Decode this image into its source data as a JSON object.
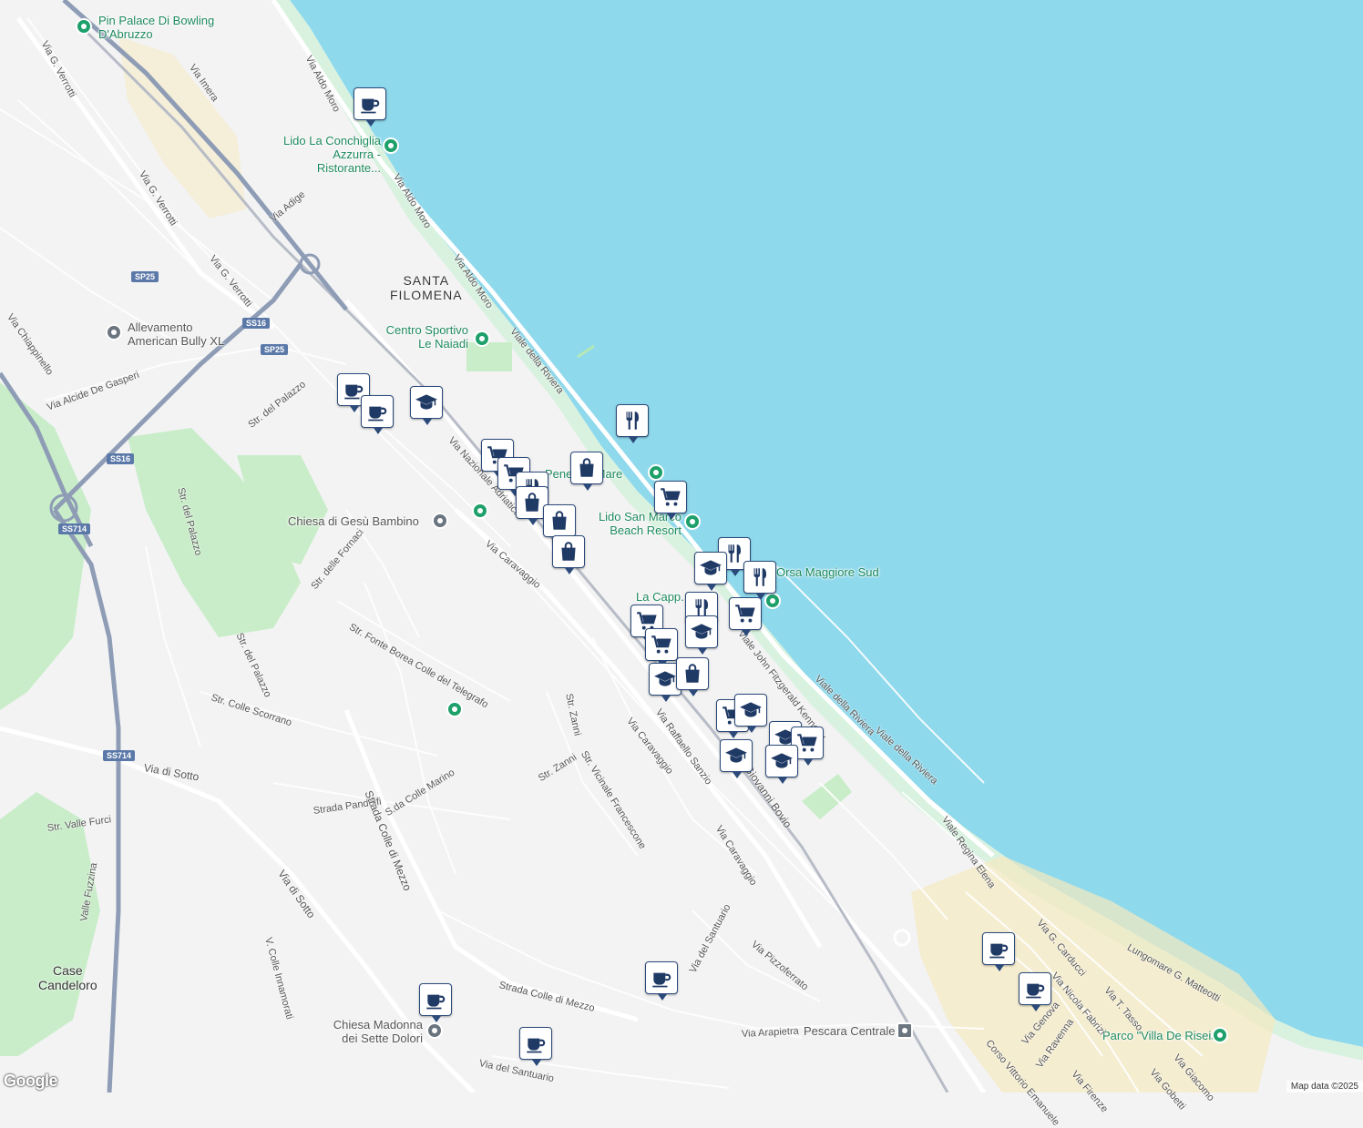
{
  "map": {
    "attribution": "Map data ©2025",
    "logo": "Google",
    "colors": {
      "sea": "#8fd9ec",
      "land": "#f3f3f4",
      "park": "#c9edc9",
      "beach": "#d9f2e0",
      "road": "#ffffff",
      "highway": "#8e9db5",
      "urban_yellow": "#f5eac1"
    }
  },
  "places": {
    "santa_filomena": "SANTA\nFILOMENA",
    "case_candeloro": "Case\nCandeloro"
  },
  "pois": [
    {
      "name": "Pin Palace Di Bowling D'Abruzzo"
    },
    {
      "name": "Lido La Conchiglia Azzurra - Ristorante..."
    },
    {
      "name": "Centro Sportivo Le Naiadi"
    },
    {
      "name": "Allevamento American Bully XL"
    },
    {
      "name": "Chiesa di Gesù Bambino"
    },
    {
      "name": "Pene... A Mare"
    },
    {
      "name": "Lido San Marco Beach Resort"
    },
    {
      "name": "Orsa Maggiore Sud"
    },
    {
      "name": "La Capp..."
    },
    {
      "name": "Chiesa Madonna dei Sette Dolori"
    },
    {
      "name": "Pescara Centrale"
    },
    {
      "name": "Parco \"Villa De Riseis\""
    }
  ],
  "road_shields": [
    "SP25",
    "SS16",
    "SP25",
    "SS16",
    "SS714",
    "SS714"
  ],
  "streets": [
    "Via Aldo Moro",
    "Via Aldo Moro",
    "Via Aldo Moro",
    "Viale della Riviera",
    "Viale della Riviera",
    "Viale della Riviera",
    "Via G. Verrotti",
    "Via G. Verrotti",
    "Via G. Verrotti",
    "Via Imera",
    "Via Adige",
    "Via Chiappinello",
    "Via Alcide De Gasperi",
    "Str. del Palazzo",
    "Str. del Palazzo",
    "Str. del Palazzo",
    "Via Nazionale Adriatica",
    "Via Caravaggio",
    "Via Caravaggio",
    "Via Caravaggio",
    "Str. delle Fornaci",
    "Str. Fonte Borea Colle del Telegrafo",
    "Str. Colle Scorrano",
    "Via di Sotto",
    "Via di Sotto",
    "Str. Valle Furci",
    "Valle Fuzzina",
    "Strada Pandolfi",
    "Strada Colle di Mezzo",
    "S.da Colle Marino",
    "Str. Zanni",
    "Str. Zanni",
    "Str. Vicinale Francescone",
    "Via Raffaello Sanzio",
    "Via Giovanni Bovio",
    "Viale John Fitzgerald Kennedy",
    "Viale Regina Elena",
    "Via del Santuario",
    "Via del Santuario",
    "Via Pizzoferrato",
    "Strada Colle di Mezzo",
    "Via Arapietra",
    "V. Colle Innamorati",
    "Via G. Carducci",
    "Via Nicola Fabrizi",
    "Via T. Tasso",
    "Lungomare G. Matteotti",
    "Via Genova",
    "Via Ravenna",
    "Via Firenze",
    "Corso Vittorio Emanuele",
    "Via Giacomo",
    "Via Gobetti"
  ],
  "markers": [
    {
      "icon": "coffee-icon"
    },
    {
      "icon": "coffee-icon"
    },
    {
      "icon": "coffee-icon"
    },
    {
      "icon": "school-icon"
    },
    {
      "icon": "restaurant-icon"
    },
    {
      "icon": "cart-icon"
    },
    {
      "icon": "cart-icon"
    },
    {
      "icon": "shopping-bag-icon"
    },
    {
      "icon": "restaurant-icon"
    },
    {
      "icon": "shopping-bag-icon"
    },
    {
      "icon": "shopping-bag-icon"
    },
    {
      "icon": "shopping-bag-icon"
    },
    {
      "icon": "cart-icon"
    },
    {
      "icon": "restaurant-icon"
    },
    {
      "icon": "restaurant-icon"
    },
    {
      "icon": "school-icon"
    },
    {
      "icon": "restaurant-icon"
    },
    {
      "icon": "cart-icon"
    },
    {
      "icon": "cart-icon"
    },
    {
      "icon": "cart-icon"
    },
    {
      "icon": "school-icon"
    },
    {
      "icon": "school-icon"
    },
    {
      "icon": "shopping-bag-icon"
    },
    {
      "icon": "cart-icon"
    },
    {
      "icon": "school-icon"
    },
    {
      "icon": "school-icon"
    },
    {
      "icon": "school-icon"
    },
    {
      "icon": "cart-icon"
    },
    {
      "icon": "school-icon"
    },
    {
      "icon": "coffee-icon"
    },
    {
      "icon": "coffee-icon"
    },
    {
      "icon": "coffee-icon"
    },
    {
      "icon": "coffee-icon"
    },
    {
      "icon": "coffee-icon"
    }
  ]
}
